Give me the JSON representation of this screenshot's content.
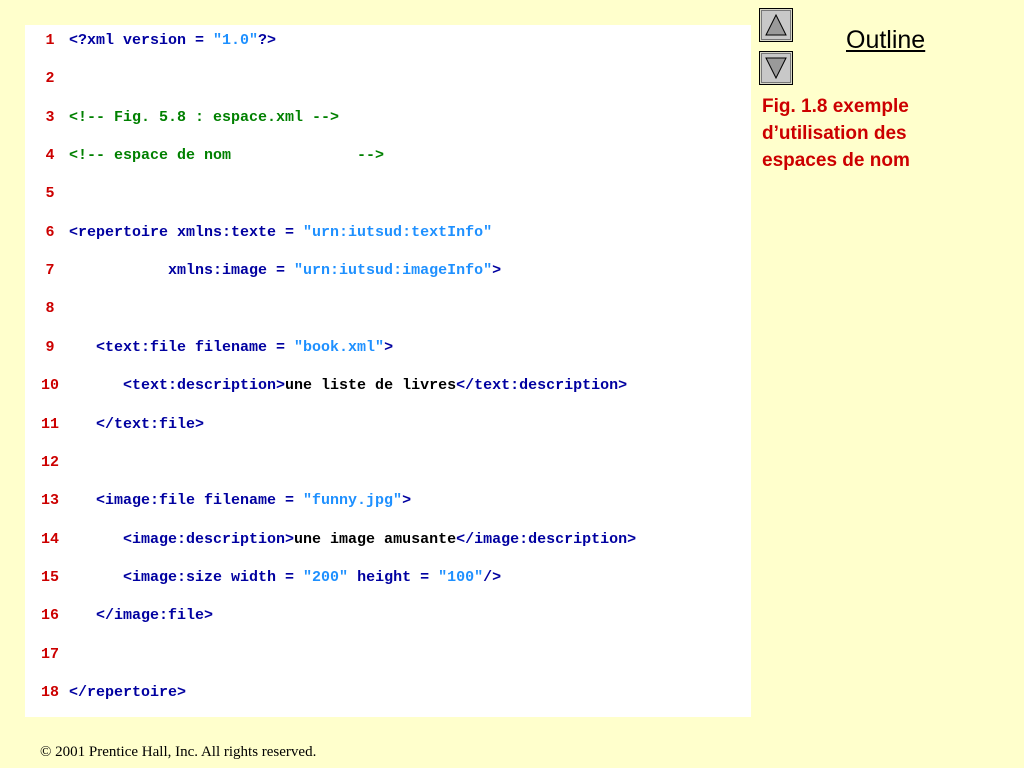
{
  "slide": {
    "outline_label": "Outline",
    "caption": "Fig. 1.8    exemple d’utilisation des espaces de nom",
    "copyright": "© 2001 Prentice Hall, Inc.  All rights reserved."
  },
  "nav": {
    "up_icon": "triangle-up-icon",
    "down_icon": "triangle-down-icon"
  },
  "colors": {
    "background": "#ffffcc",
    "line_number": "#cc0000",
    "tag": "#0000a0",
    "string": "#1e90ff",
    "comment": "#008000",
    "text": "#000000",
    "caption": "#cc0000"
  },
  "code": [
    {
      "num": "1",
      "parts": [
        [
          "t",
          "<?xml version = "
        ],
        [
          "s",
          "\"1.0\""
        ],
        [
          "t",
          "?>"
        ]
      ]
    },
    {
      "num": "2",
      "parts": []
    },
    {
      "num": "3",
      "parts": [
        [
          "c",
          "<!-- Fig. 5.8 : espace.xml -->"
        ]
      ]
    },
    {
      "num": "4",
      "parts": [
        [
          "c",
          "<!-- espace de nom              -->"
        ]
      ]
    },
    {
      "num": "5",
      "parts": []
    },
    {
      "num": "6",
      "parts": [
        [
          "t",
          "<repertoire xmlns:texte = "
        ],
        [
          "s",
          "\"urn:iutsud:textInfo\""
        ]
      ]
    },
    {
      "num": "7",
      "parts": [
        [
          "t",
          "           xmlns:image = "
        ],
        [
          "s",
          "\"urn:iutsud:imageInfo\""
        ],
        [
          "t",
          ">"
        ]
      ]
    },
    {
      "num": "8",
      "parts": []
    },
    {
      "num": "9",
      "parts": [
        [
          "t",
          "   <text:file filename = "
        ],
        [
          "s",
          "\"book.xml\""
        ],
        [
          "t",
          ">"
        ]
      ]
    },
    {
      "num": "10",
      "parts": [
        [
          "t",
          "      <text:description>"
        ],
        [
          "x",
          "une liste de livres"
        ],
        [
          "t",
          "</text:description>"
        ]
      ]
    },
    {
      "num": "11",
      "parts": [
        [
          "t",
          "   </text:file>"
        ]
      ]
    },
    {
      "num": "12",
      "parts": []
    },
    {
      "num": "13",
      "parts": [
        [
          "t",
          "   <image:file filename = "
        ],
        [
          "s",
          "\"funny.jpg\""
        ],
        [
          "t",
          ">"
        ]
      ]
    },
    {
      "num": "14",
      "parts": [
        [
          "t",
          "      <image:description>"
        ],
        [
          "x",
          "une image amusante"
        ],
        [
          "t",
          "</image:description>"
        ]
      ]
    },
    {
      "num": "15",
      "parts": [
        [
          "t",
          "      <image:size width = "
        ],
        [
          "s",
          "\"200\""
        ],
        [
          "t",
          " height = "
        ],
        [
          "s",
          "\"100\""
        ],
        [
          "t",
          "/>"
        ]
      ]
    },
    {
      "num": "16",
      "parts": [
        [
          "t",
          "   </image:file>"
        ]
      ]
    },
    {
      "num": "17",
      "parts": []
    },
    {
      "num": "18",
      "parts": [
        [
          "t",
          "</repertoire>"
        ]
      ]
    }
  ]
}
